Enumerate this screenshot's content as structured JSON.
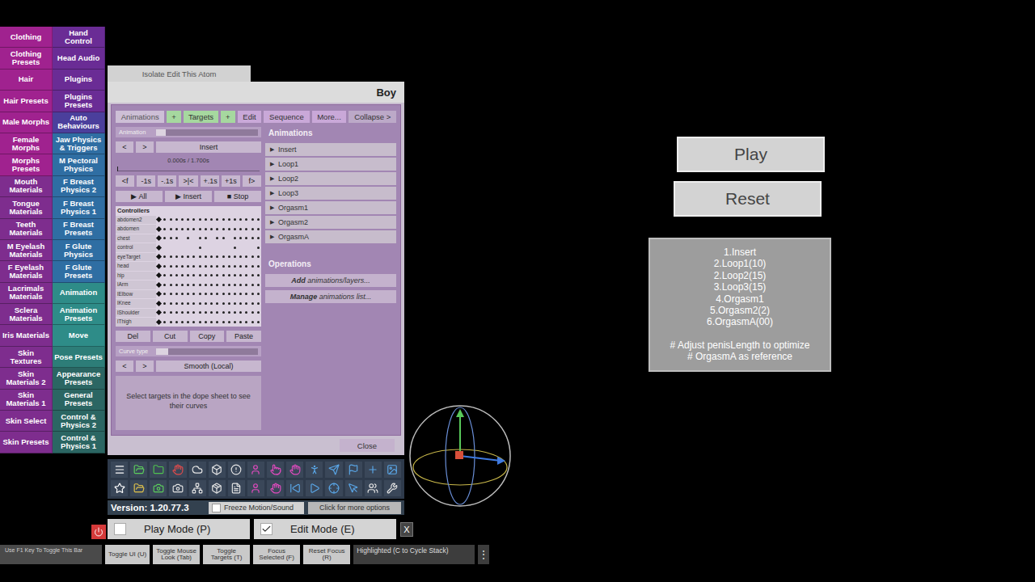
{
  "menu": {
    "left": [
      {
        "label": "Clothing",
        "color": "#a0228f"
      },
      {
        "label": "Clothing Presets",
        "color": "#a0228f"
      },
      {
        "label": "Hair",
        "color": "#a0228f"
      },
      {
        "label": "Hair Presets",
        "color": "#a0228f"
      },
      {
        "label": "Male Morphs",
        "color": "#a0228f"
      },
      {
        "label": "Female Morphs",
        "color": "#a0228f"
      },
      {
        "label": "Morphs Presets",
        "color": "#a0228f"
      },
      {
        "label": "Mouth Materials",
        "color": "#7e2d8e"
      },
      {
        "label": "Tongue Materials",
        "color": "#7e2d8e"
      },
      {
        "label": "Teeth Materials",
        "color": "#7e2d8e"
      },
      {
        "label": "M Eyelash Materials",
        "color": "#7e2d8e"
      },
      {
        "label": "F Eyelash Materials",
        "color": "#7e2d8e"
      },
      {
        "label": "Lacrimals Materials",
        "color": "#7e2d8e"
      },
      {
        "label": "Sclera Materials",
        "color": "#7e2d8e"
      },
      {
        "label": "Iris Materials",
        "color": "#7e2d8e"
      },
      {
        "label": "Skin Textures",
        "color": "#7e2d8e"
      },
      {
        "label": "Skin Materials 2",
        "color": "#7e2d8e"
      },
      {
        "label": "Skin Materials 1",
        "color": "#7e2d8e"
      },
      {
        "label": "Skin Select",
        "color": "#7e2d8e"
      },
      {
        "label": "Skin Presets",
        "color": "#7e2d8e"
      }
    ],
    "right": [
      {
        "label": "Hand Control",
        "color": "#6a2c95"
      },
      {
        "label": "Head Audio",
        "color": "#6a2c95"
      },
      {
        "label": "Plugins",
        "color": "#6a2c95"
      },
      {
        "label": "Plugins Presets",
        "color": "#6a2c95"
      },
      {
        "label": "Auto Behaviours",
        "color": "#4b3f9c"
      },
      {
        "label": "Jaw Physics & Triggers",
        "color": "#2f6ea3"
      },
      {
        "label": "M Pectoral Physics",
        "color": "#2f6ea3"
      },
      {
        "label": "F Breast Physics 2",
        "color": "#2f6ea3"
      },
      {
        "label": "F Breast Physics 1",
        "color": "#2f6ea3"
      },
      {
        "label": "F Breast Presets",
        "color": "#2f6ea3"
      },
      {
        "label": "F Glute Physics",
        "color": "#2f6ea3"
      },
      {
        "label": "F Glute Presets",
        "color": "#2f6ea3"
      },
      {
        "label": "Animation",
        "color": "#2e8c88"
      },
      {
        "label": "Animation Presets",
        "color": "#2e8c88"
      },
      {
        "label": "Move",
        "color": "#2e8c88"
      },
      {
        "label": "Pose Presets",
        "color": "#2d7d78"
      },
      {
        "label": "Appearance Presets",
        "color": "#2b6663"
      },
      {
        "label": "General Presets",
        "color": "#2b6663"
      },
      {
        "label": "Control & Physics 2",
        "color": "#2b6663"
      },
      {
        "label": "Control & Physics 1",
        "color": "#2b6663"
      }
    ]
  },
  "isolate_button": "Isolate Edit This Atom",
  "panel": {
    "title": "Boy",
    "tabs": [
      {
        "label": "Animations",
        "selected": true,
        "kind": "tab"
      },
      {
        "label": "+",
        "selected": false,
        "kind": "green"
      },
      {
        "label": "Targets",
        "selected": false,
        "kind": "green"
      },
      {
        "label": "+",
        "selected": false,
        "kind": "green"
      },
      {
        "label": "Edit",
        "selected": false,
        "kind": "menu"
      },
      {
        "label": "Sequence",
        "selected": false,
        "kind": "menu"
      },
      {
        "label": "More...",
        "selected": false,
        "kind": "menu"
      },
      {
        "label": "Collapse >",
        "selected": false,
        "kind": "collapse"
      }
    ],
    "animation_slider": {
      "label": "Animation",
      "level": 0.04
    },
    "animation_nav": {
      "prev": "<",
      "next": ">",
      "current": "Insert"
    },
    "time": {
      "reading": "0.000s / 1.700s",
      "level": 0.0
    },
    "step_buttons": [
      "<f",
      "-1s",
      "-.1s",
      ">|<",
      "+.1s",
      "+1s",
      "f>"
    ],
    "play_buttons": [
      "▶ All",
      "▶ Insert",
      "■ Stop"
    ],
    "controllers": {
      "header": "Controllers",
      "rows": [
        {
          "name": "abdomen2",
          "keys": [
            1,
            1,
            1,
            1,
            1,
            1,
            1,
            1,
            1,
            1,
            1,
            1,
            1,
            1,
            1,
            1,
            1,
            1
          ]
        },
        {
          "name": "abdomen",
          "keys": [
            1,
            1,
            1,
            1,
            1,
            1,
            1,
            1,
            1,
            1,
            1,
            1,
            1,
            1,
            1,
            1,
            1,
            1
          ]
        },
        {
          "name": "chest",
          "keys": [
            1,
            1,
            1,
            1,
            0,
            1,
            0,
            1,
            1,
            0,
            1,
            1,
            0,
            1,
            1,
            1,
            1,
            1
          ]
        },
        {
          "name": "control",
          "keys": [
            1,
            0,
            0,
            0,
            0,
            0,
            0,
            1,
            0,
            0,
            0,
            0,
            0,
            1,
            0,
            0,
            0,
            1
          ]
        },
        {
          "name": "eyeTarget",
          "keys": [
            1,
            1,
            1,
            1,
            1,
            1,
            1,
            1,
            1,
            1,
            1,
            1,
            1,
            1,
            1,
            1,
            1,
            1
          ]
        },
        {
          "name": "head",
          "keys": [
            1,
            1,
            1,
            1,
            1,
            1,
            1,
            1,
            1,
            1,
            1,
            1,
            1,
            1,
            1,
            1,
            1,
            1
          ]
        },
        {
          "name": "hip",
          "keys": [
            1,
            1,
            1,
            1,
            1,
            1,
            1,
            1,
            1,
            1,
            1,
            1,
            1,
            1,
            1,
            1,
            1,
            1
          ]
        },
        {
          "name": "lArm",
          "keys": [
            1,
            1,
            1,
            1,
            1,
            1,
            1,
            1,
            1,
            1,
            1,
            1,
            1,
            1,
            1,
            1,
            1,
            1
          ]
        },
        {
          "name": "lElbow",
          "keys": [
            1,
            1,
            1,
            1,
            1,
            1,
            1,
            1,
            1,
            1,
            1,
            1,
            1,
            1,
            1,
            1,
            1,
            1
          ]
        },
        {
          "name": "lKnee",
          "keys": [
            1,
            1,
            1,
            1,
            1,
            1,
            1,
            1,
            1,
            1,
            1,
            1,
            1,
            1,
            1,
            1,
            1,
            1
          ]
        },
        {
          "name": "lShoulder",
          "keys": [
            1,
            1,
            1,
            1,
            1,
            1,
            1,
            1,
            1,
            1,
            1,
            1,
            1,
            1,
            1,
            1,
            1,
            1
          ]
        },
        {
          "name": "lThigh",
          "keys": [
            1,
            1,
            1,
            1,
            1,
            1,
            1,
            1,
            1,
            1,
            1,
            1,
            1,
            1,
            1,
            1,
            1,
            1
          ]
        }
      ]
    },
    "edit_buttons": [
      "Del",
      "Cut",
      "Copy",
      "Paste"
    ],
    "curve_slider": {
      "label": "Curve type",
      "level": 0.12
    },
    "curve_nav": {
      "prev": "<",
      "next": ">",
      "current": "Smooth (Local)"
    },
    "info": "Select targets in the dope sheet to see their curves",
    "animations_header": "Animations",
    "animations": [
      {
        "glyph": "▶",
        "label": "Insert",
        "expanded": false
      },
      {
        "glyph": "▶",
        "label": "Loop1",
        "expanded": false
      },
      {
        "glyph": "▶",
        "label": "Loop2",
        "expanded": false
      },
      {
        "glyph": "▶",
        "label": "Loop3",
        "expanded": false
      },
      {
        "glyph": "▶",
        "label": "Orgasm1",
        "expanded": false
      },
      {
        "glyph": "▶",
        "label": "Orgasm2",
        "expanded": false
      },
      {
        "glyph": "▶",
        "label": "OrgasmA",
        "expanded": false
      }
    ],
    "operations_header": "Operations",
    "operations": [
      {
        "bold": "Add",
        "rest": " animations/layers..."
      },
      {
        "bold": "Manage",
        "rest": " animations list..."
      }
    ],
    "close": "Close"
  },
  "version": "Version: 1.20.77.3",
  "freeze": {
    "label": "Freeze Motion/Sound",
    "checked": false
  },
  "more_options": "Click for more options",
  "modes": [
    {
      "label": "Play Mode (P)",
      "checked": false
    },
    {
      "label": "Edit Mode (E)",
      "checked": true
    }
  ],
  "close_x": "X",
  "bottom_bar": {
    "hint": "Use F1 Key To Toggle This Bar",
    "buttons": [
      "Toggle UI (U)",
      "Toggle Mouse Look (Tab)",
      "Toggle Targets (T)",
      "Focus Selected (F)",
      "Reset Focus (R)"
    ],
    "highlighted": "Highlighted (C to Cycle Stack)",
    "menu_glyph": "⋮"
  },
  "scene": {
    "buttons": [
      "Play",
      "Reset"
    ],
    "info_lines": [
      "1.Insert",
      "2.Loop1(10)",
      "2.Loop2(15)",
      "3.Loop3(15)",
      "4.Orgasm1",
      "5.Orgasm2(2)",
      "6.OrgasmA(00)"
    ],
    "info_notes": [
      "# Adjust penisLength to optimize",
      "# OrgasmA as reference"
    ]
  }
}
